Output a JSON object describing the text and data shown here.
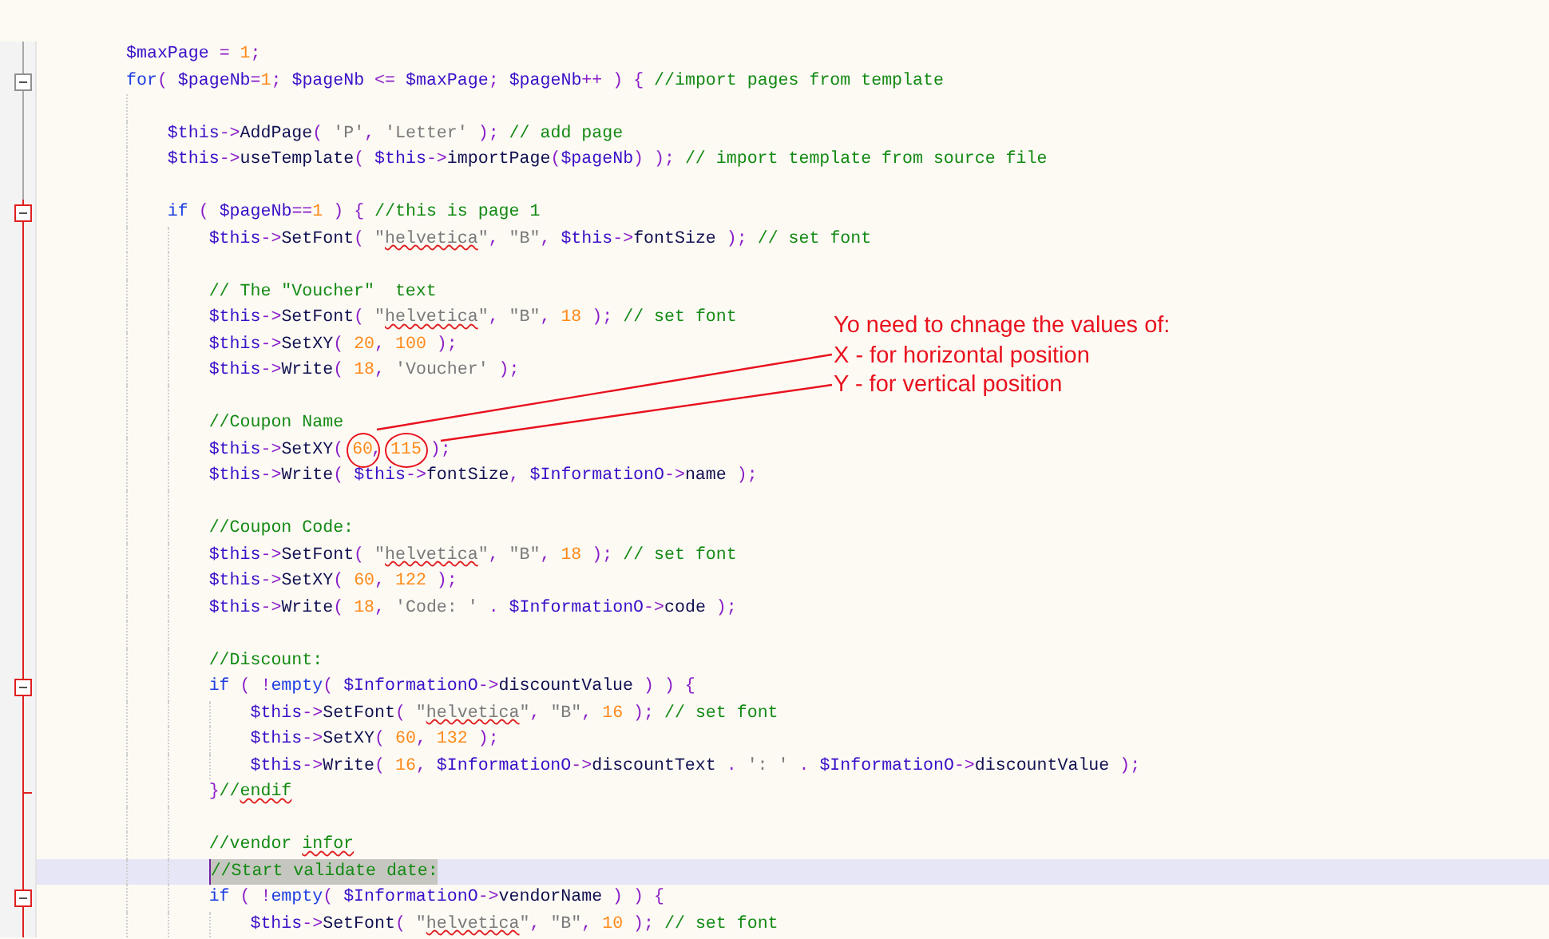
{
  "editor": {
    "lines": [
      {
        "current": false,
        "active": false,
        "tokens": [
          {
            "kind": "var",
            "text": "$maxPage"
          },
          {
            "kind": "op",
            "text": " = "
          },
          {
            "kind": "num",
            "text": "1"
          },
          {
            "kind": "op",
            "text": ";"
          }
        ]
      },
      {
        "current": false,
        "active": false,
        "kind": "fold_start",
        "tokens": [
          {
            "kind": "keyword",
            "text": "for"
          },
          {
            "kind": "op",
            "text": "( "
          },
          {
            "kind": "var",
            "text": "$pageNb"
          },
          {
            "kind": "op",
            "text": "="
          },
          {
            "kind": "num",
            "text": "1"
          },
          {
            "kind": "op",
            "text": "; "
          },
          {
            "kind": "var",
            "text": "$pageNb"
          },
          {
            "kind": "op",
            "text": " <= "
          },
          {
            "kind": "var",
            "text": "$maxPage"
          },
          {
            "kind": "op",
            "text": "; "
          },
          {
            "kind": "var",
            "text": "$pageNb"
          },
          {
            "kind": "op",
            "text": "++ ) { "
          },
          {
            "kind": "comment",
            "text": "//import pages from template"
          }
        ],
        "children": [
          {
            "current": false,
            "active": false
          },
          {
            "current": false,
            "active": false,
            "tokens": [
              {
                "kind": "var",
                "text": "$this"
              },
              {
                "kind": "op",
                "text": "->"
              },
              {
                "kind": "name",
                "text": "AddPage"
              },
              {
                "kind": "op",
                "text": "( "
              },
              {
                "kind": "str",
                "text": "'P'"
              },
              {
                "kind": "op",
                "text": ", "
              },
              {
                "kind": "str",
                "text": "'Letter'"
              },
              {
                "kind": "op",
                "text": " ); "
              },
              {
                "kind": "comment",
                "text": "// add page"
              }
            ]
          },
          {
            "current": false,
            "active": false,
            "tokens": [
              {
                "kind": "var",
                "text": "$this"
              },
              {
                "kind": "op",
                "text": "->"
              },
              {
                "kind": "name",
                "text": "useTemplate"
              },
              {
                "kind": "op",
                "text": "( "
              },
              {
                "kind": "var",
                "text": "$this"
              },
              {
                "kind": "op",
                "text": "->"
              },
              {
                "kind": "name",
                "text": "importPage"
              },
              {
                "kind": "op",
                "text": "("
              },
              {
                "kind": "var",
                "text": "$pageNb"
              },
              {
                "kind": "op",
                "text": ") ); "
              },
              {
                "kind": "comment",
                "text": "// import template from source file"
              }
            ]
          },
          {
            "current": false,
            "active": false
          },
          {
            "current": false,
            "active": true,
            "kind": "fold_start",
            "tokens": [
              {
                "kind": "keyword",
                "text": "if"
              },
              {
                "kind": "op",
                "text": " ( "
              },
              {
                "kind": "var",
                "text": "$pageNb"
              },
              {
                "kind": "op",
                "text": "=="
              },
              {
                "kind": "num",
                "text": "1"
              },
              {
                "kind": "op",
                "text": " ) { "
              },
              {
                "kind": "comment",
                "text": "//this is page 1"
              }
            ],
            "children": [
              {
                "current": false,
                "active": true,
                "tokens": [
                  {
                    "kind": "var",
                    "text": "$this"
                  },
                  {
                    "kind": "op",
                    "text": "->"
                  },
                  {
                    "kind": "name",
                    "text": "SetFont"
                  },
                  {
                    "kind": "op",
                    "text": "( "
                  },
                  {
                    "kind": "str",
                    "text": "\""
                  },
                  {
                    "kind": "str_typo",
                    "text": "helvetica"
                  },
                  {
                    "kind": "str",
                    "text": "\""
                  },
                  {
                    "kind": "op",
                    "text": ", "
                  },
                  {
                    "kind": "str",
                    "text": "\"B\""
                  },
                  {
                    "kind": "op",
                    "text": ", "
                  },
                  {
                    "kind": "var",
                    "text": "$this"
                  },
                  {
                    "kind": "op",
                    "text": "->"
                  },
                  {
                    "kind": "name",
                    "text": "fontSize"
                  },
                  {
                    "kind": "op",
                    "text": " ); "
                  },
                  {
                    "kind": "comment",
                    "text": "// set font"
                  }
                ]
              },
              {
                "current": false,
                "active": true
              },
              {
                "current": false,
                "active": true,
                "tokens": [
                  {
                    "kind": "comment",
                    "text": "// The \"Voucher\"  text"
                  }
                ]
              },
              {
                "current": false,
                "active": true,
                "tokens": [
                  {
                    "kind": "var",
                    "text": "$this"
                  },
                  {
                    "kind": "op",
                    "text": "->"
                  },
                  {
                    "kind": "name",
                    "text": "SetFont"
                  },
                  {
                    "kind": "op",
                    "text": "( "
                  },
                  {
                    "kind": "str",
                    "text": "\""
                  },
                  {
                    "kind": "str_typo",
                    "text": "helvetica"
                  },
                  {
                    "kind": "str",
                    "text": "\""
                  },
                  {
                    "kind": "op",
                    "text": ", "
                  },
                  {
                    "kind": "str",
                    "text": "\"B\""
                  },
                  {
                    "kind": "op",
                    "text": ", "
                  },
                  {
                    "kind": "num",
                    "text": "18"
                  },
                  {
                    "kind": "op",
                    "text": " ); "
                  },
                  {
                    "kind": "comment",
                    "text": "// set font"
                  }
                ]
              },
              {
                "current": false,
                "active": true,
                "tokens": [
                  {
                    "kind": "var",
                    "text": "$this"
                  },
                  {
                    "kind": "op",
                    "text": "->"
                  },
                  {
                    "kind": "name",
                    "text": "SetXY"
                  },
                  {
                    "kind": "op",
                    "text": "( "
                  },
                  {
                    "kind": "num",
                    "text": "20"
                  },
                  {
                    "kind": "op",
                    "text": ", "
                  },
                  {
                    "kind": "num",
                    "text": "100"
                  },
                  {
                    "kind": "op",
                    "text": " );"
                  }
                ]
              },
              {
                "current": false,
                "active": true,
                "tokens": [
                  {
                    "kind": "var",
                    "text": "$this"
                  },
                  {
                    "kind": "op",
                    "text": "->"
                  },
                  {
                    "kind": "name",
                    "text": "Write"
                  },
                  {
                    "kind": "op",
                    "text": "( "
                  },
                  {
                    "kind": "num",
                    "text": "18"
                  },
                  {
                    "kind": "op",
                    "text": ", "
                  },
                  {
                    "kind": "str",
                    "text": "'Voucher'"
                  },
                  {
                    "kind": "op",
                    "text": " );"
                  }
                ]
              },
              {
                "current": false,
                "active": true
              },
              {
                "current": false,
                "active": true,
                "tokens": [
                  {
                    "kind": "comment",
                    "text": "//Coupon Name"
                  }
                ]
              },
              {
                "current": false,
                "active": true,
                "tokens": [
                  {
                    "kind": "var",
                    "text": "$this"
                  },
                  {
                    "kind": "op",
                    "text": "->"
                  },
                  {
                    "kind": "name",
                    "text": "SetXY"
                  },
                  {
                    "kind": "op",
                    "text": "( "
                  },
                  {
                    "kind": "num",
                    "text": "60",
                    "circled": true
                  },
                  {
                    "kind": "op",
                    "text": ", "
                  },
                  {
                    "kind": "num",
                    "text": "115",
                    "circled": true
                  },
                  {
                    "kind": "op",
                    "text": " );"
                  }
                ]
              },
              {
                "current": false,
                "active": true,
                "tokens": [
                  {
                    "kind": "var",
                    "text": "$this"
                  },
                  {
                    "kind": "op",
                    "text": "->"
                  },
                  {
                    "kind": "name",
                    "text": "Write"
                  },
                  {
                    "kind": "op",
                    "text": "( "
                  },
                  {
                    "kind": "var",
                    "text": "$this"
                  },
                  {
                    "kind": "op",
                    "text": "->"
                  },
                  {
                    "kind": "name",
                    "text": "fontSize"
                  },
                  {
                    "kind": "op",
                    "text": ", "
                  },
                  {
                    "kind": "var",
                    "text": "$InformationO"
                  },
                  {
                    "kind": "op",
                    "text": "->"
                  },
                  {
                    "kind": "name",
                    "text": "name"
                  },
                  {
                    "kind": "op",
                    "text": " );"
                  }
                ]
              },
              {
                "current": false,
                "active": true
              },
              {
                "current": false,
                "active": true,
                "tokens": [
                  {
                    "kind": "comment",
                    "text": "//Coupon Code:"
                  }
                ]
              },
              {
                "current": false,
                "active": true,
                "tokens": [
                  {
                    "kind": "var",
                    "text": "$this"
                  },
                  {
                    "kind": "op",
                    "text": "->"
                  },
                  {
                    "kind": "name",
                    "text": "SetFont"
                  },
                  {
                    "kind": "op",
                    "text": "( "
                  },
                  {
                    "kind": "str",
                    "text": "\""
                  },
                  {
                    "kind": "str_typo",
                    "text": "helvetica"
                  },
                  {
                    "kind": "str",
                    "text": "\""
                  },
                  {
                    "kind": "op",
                    "text": ", "
                  },
                  {
                    "kind": "str",
                    "text": "\"B\""
                  },
                  {
                    "kind": "op",
                    "text": ", "
                  },
                  {
                    "kind": "num",
                    "text": "18"
                  },
                  {
                    "kind": "op",
                    "text": " ); "
                  },
                  {
                    "kind": "comment",
                    "text": "// set font"
                  }
                ]
              },
              {
                "current": false,
                "active": true,
                "tokens": [
                  {
                    "kind": "var",
                    "text": "$this"
                  },
                  {
                    "kind": "op",
                    "text": "->"
                  },
                  {
                    "kind": "name",
                    "text": "SetXY"
                  },
                  {
                    "kind": "op",
                    "text": "( "
                  },
                  {
                    "kind": "num",
                    "text": "60"
                  },
                  {
                    "kind": "op",
                    "text": ", "
                  },
                  {
                    "kind": "num",
                    "text": "122"
                  },
                  {
                    "kind": "op",
                    "text": " );"
                  }
                ]
              },
              {
                "current": false,
                "active": true,
                "tokens": [
                  {
                    "kind": "var",
                    "text": "$this"
                  },
                  {
                    "kind": "op",
                    "text": "->"
                  },
                  {
                    "kind": "name",
                    "text": "Write"
                  },
                  {
                    "kind": "op",
                    "text": "( "
                  },
                  {
                    "kind": "num",
                    "text": "18"
                  },
                  {
                    "kind": "op",
                    "text": ", "
                  },
                  {
                    "kind": "str",
                    "text": "'Code: '"
                  },
                  {
                    "kind": "op",
                    "text": " . "
                  },
                  {
                    "kind": "var",
                    "text": "$InformationO"
                  },
                  {
                    "kind": "op",
                    "text": "->"
                  },
                  {
                    "kind": "name",
                    "text": "code"
                  },
                  {
                    "kind": "op",
                    "text": " );"
                  }
                ]
              },
              {
                "current": false,
                "active": true
              },
              {
                "current": false,
                "active": true,
                "tokens": [
                  {
                    "kind": "comment",
                    "text": "//Discount:"
                  }
                ]
              },
              {
                "current": false,
                "active": true,
                "kind": "fold_start",
                "tokens": [
                  {
                    "kind": "keyword",
                    "text": "if"
                  },
                  {
                    "kind": "op",
                    "text": " ( !"
                  },
                  {
                    "kind": "keyword",
                    "text": "empty"
                  },
                  {
                    "kind": "op",
                    "text": "( "
                  },
                  {
                    "kind": "var",
                    "text": "$InformationO"
                  },
                  {
                    "kind": "op",
                    "text": "->"
                  },
                  {
                    "kind": "name",
                    "text": "discountValue"
                  },
                  {
                    "kind": "op",
                    "text": " ) ) {"
                  }
                ],
                "children": [
                  {
                    "current": false,
                    "active": true,
                    "tokens": [
                      {
                        "kind": "var",
                        "text": "$this"
                      },
                      {
                        "kind": "op",
                        "text": "->"
                      },
                      {
                        "kind": "name",
                        "text": "SetFont"
                      },
                      {
                        "kind": "op",
                        "text": "( "
                      },
                      {
                        "kind": "str",
                        "text": "\""
                      },
                      {
                        "kind": "str_typo",
                        "text": "helvetica"
                      },
                      {
                        "kind": "str",
                        "text": "\""
                      },
                      {
                        "kind": "op",
                        "text": ", "
                      },
                      {
                        "kind": "str",
                        "text": "\"B\""
                      },
                      {
                        "kind": "op",
                        "text": ", "
                      },
                      {
                        "kind": "num",
                        "text": "16"
                      },
                      {
                        "kind": "op",
                        "text": " ); "
                      },
                      {
                        "kind": "comment",
                        "text": "// set font"
                      }
                    ]
                  },
                  {
                    "current": false,
                    "active": true,
                    "tokens": [
                      {
                        "kind": "var",
                        "text": "$this"
                      },
                      {
                        "kind": "op",
                        "text": "->"
                      },
                      {
                        "kind": "name",
                        "text": "SetXY"
                      },
                      {
                        "kind": "op",
                        "text": "( "
                      },
                      {
                        "kind": "num",
                        "text": "60"
                      },
                      {
                        "kind": "op",
                        "text": ", "
                      },
                      {
                        "kind": "num",
                        "text": "132"
                      },
                      {
                        "kind": "op",
                        "text": " );"
                      }
                    ]
                  },
                  {
                    "current": false,
                    "active": true,
                    "tokens": [
                      {
                        "kind": "var",
                        "text": "$this"
                      },
                      {
                        "kind": "op",
                        "text": "->"
                      },
                      {
                        "kind": "name",
                        "text": "Write"
                      },
                      {
                        "kind": "op",
                        "text": "( "
                      },
                      {
                        "kind": "num",
                        "text": "16"
                      },
                      {
                        "kind": "op",
                        "text": ", "
                      },
                      {
                        "kind": "var",
                        "text": "$InformationO"
                      },
                      {
                        "kind": "op",
                        "text": "->"
                      },
                      {
                        "kind": "name",
                        "text": "discountText"
                      },
                      {
                        "kind": "op",
                        "text": " . "
                      },
                      {
                        "kind": "str",
                        "text": "': '"
                      },
                      {
                        "kind": "op",
                        "text": " . "
                      },
                      {
                        "kind": "var",
                        "text": "$InformationO"
                      },
                      {
                        "kind": "op",
                        "text": "->"
                      },
                      {
                        "kind": "name",
                        "text": "discountValue"
                      },
                      {
                        "kind": "op",
                        "text": " );"
                      }
                    ]
                  }
                ]
              },
              {
                "current": false,
                "active": true,
                "kind": "fold_end",
                "tokens": [
                  {
                    "kind": "op",
                    "text": "}"
                  },
                  {
                    "kind": "comment",
                    "text": "//"
                  },
                  {
                    "kind": "comment_typo",
                    "text": "endif"
                  }
                ]
              },
              {
                "current": false,
                "active": true
              },
              {
                "current": false,
                "active": true,
                "tokens": [
                  {
                    "kind": "comment",
                    "text": "//vendor "
                  },
                  {
                    "kind": "comment_typo",
                    "text": "infor"
                  }
                ]
              },
              {
                "current": true,
                "active": true,
                "tokens": [
                  {
                    "kind": "comment",
                    "text": "//Start validate date:"
                  }
                ]
              },
              {
                "current": false,
                "active": true,
                "kind": "fold_start",
                "tokens": [
                  {
                    "kind": "keyword",
                    "text": "if"
                  },
                  {
                    "kind": "op",
                    "text": " ( !"
                  },
                  {
                    "kind": "keyword",
                    "text": "empty"
                  },
                  {
                    "kind": "op",
                    "text": "( "
                  },
                  {
                    "kind": "var",
                    "text": "$InformationO"
                  },
                  {
                    "kind": "op",
                    "text": "->"
                  },
                  {
                    "kind": "name",
                    "text": "vendorName"
                  },
                  {
                    "kind": "op",
                    "text": " ) ) {"
                  }
                ],
                "children": [
                  {
                    "current": false,
                    "active": true,
                    "tokens": [
                      {
                        "kind": "var",
                        "text": "$this"
                      },
                      {
                        "kind": "op",
                        "text": "->"
                      },
                      {
                        "kind": "name",
                        "text": "SetFont"
                      },
                      {
                        "kind": "op",
                        "text": "( "
                      },
                      {
                        "kind": "str",
                        "text": "\""
                      },
                      {
                        "kind": "str_typo",
                        "text": "helvetica"
                      },
                      {
                        "kind": "str",
                        "text": "\""
                      },
                      {
                        "kind": "op",
                        "text": ", "
                      },
                      {
                        "kind": "str",
                        "text": "\"B\""
                      },
                      {
                        "kind": "op",
                        "text": ", "
                      },
                      {
                        "kind": "num",
                        "text": "10"
                      },
                      {
                        "kind": "op",
                        "text": " ); "
                      },
                      {
                        "kind": "comment",
                        "text": "// set font"
                      }
                    ]
                  }
                ]
              }
            ]
          }
        ]
      }
    ]
  },
  "annotation": {
    "lines": [
      "Yo need  to chnage the values of:",
      "X - for horizontal position",
      "Y - for vertical position"
    ]
  }
}
